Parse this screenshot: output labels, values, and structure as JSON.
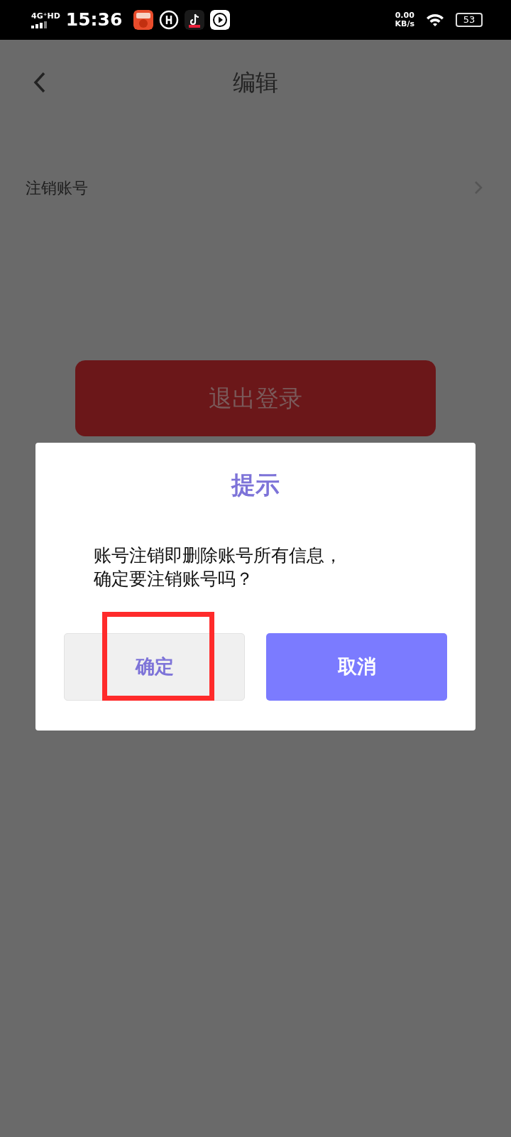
{
  "status_bar": {
    "network": "4G⁺HD",
    "time": "15:36",
    "speed": "0.00",
    "speed_unit": "KB/s",
    "battery": "53"
  },
  "header": {
    "title": "编辑"
  },
  "settings": [
    {
      "label": "注销账号"
    }
  ],
  "logout_button": {
    "label": "退出登录"
  },
  "dialog": {
    "title": "提示",
    "message": "账号注销即删除账号所有信息，确定要注销账号吗？",
    "buttons": [
      {
        "label": "确定",
        "kind": "plain",
        "highlighted": true
      },
      {
        "label": "取消",
        "kind": "primary",
        "highlighted": false
      }
    ]
  }
}
